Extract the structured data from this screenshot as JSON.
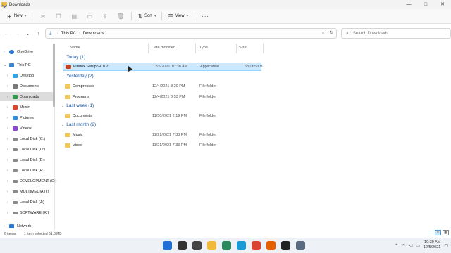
{
  "window": {
    "title": "Downloads",
    "controls": [
      "—",
      "□",
      "✕"
    ]
  },
  "toolbar": {
    "new_label": "New",
    "sort_label": "Sort",
    "view_label": "View",
    "more": "···"
  },
  "address": {
    "crumbs": [
      "This PC",
      "Downloads"
    ],
    "search_placeholder": "Search Downloads"
  },
  "sidebar": {
    "items": [
      {
        "label": "OneDrive",
        "icon": "cloud-icon",
        "color": "#2a7ad5"
      },
      {
        "label": "This PC",
        "icon": "computer-icon",
        "color": "#3b83d4"
      },
      {
        "label": "Desktop",
        "icon": "desktop-icon",
        "color": "#2fa4e7"
      },
      {
        "label": "Documents",
        "icon": "documents-icon",
        "color": "#7a7a7a"
      },
      {
        "label": "Downloads",
        "icon": "download-icon",
        "color": "#2a9d4a"
      },
      {
        "label": "Music",
        "icon": "music-icon",
        "color": "#d9462b"
      },
      {
        "label": "Pictures",
        "icon": "pictures-icon",
        "color": "#2d8be0"
      },
      {
        "label": "Videos",
        "icon": "videos-icon",
        "color": "#8a4bd0"
      },
      {
        "label": "Local Disk (C:)",
        "icon": "drive-icon",
        "color": "#8a8a8a"
      },
      {
        "label": "Local Disk (D:)",
        "icon": "drive-icon",
        "color": "#8a8a8a"
      },
      {
        "label": "Local Disk (E:)",
        "icon": "drive-icon",
        "color": "#8a8a8a"
      },
      {
        "label": "Local Disk (F:)",
        "icon": "drive-icon",
        "color": "#8a8a8a"
      },
      {
        "label": "DEVELOPMENT (G:)",
        "icon": "drive-icon",
        "color": "#8a8a8a"
      },
      {
        "label": "MULTIMEDIA (I:)",
        "icon": "drive-icon",
        "color": "#8a8a8a"
      },
      {
        "label": "Local Disk (J:)",
        "icon": "drive-icon",
        "color": "#8a8a8a"
      },
      {
        "label": "SOFTWARE (K:)",
        "icon": "drive-icon",
        "color": "#8a8a8a"
      },
      {
        "label": "Network",
        "icon": "network-icon",
        "color": "#2a7ad5"
      }
    ]
  },
  "columns": {
    "name": "Name",
    "date": "Date modified",
    "type": "Type",
    "size": "Size"
  },
  "groups": [
    {
      "label": "Today (1)"
    },
    {
      "label": "Yesterday (2)"
    },
    {
      "label": "Last week (1)"
    },
    {
      "label": "Last month (2)"
    }
  ],
  "files": [
    {
      "name": "Firefox Setup 94.0.2",
      "date": "12/5/2021 10:38 AM",
      "type": "Application",
      "size": "53,065 KB"
    },
    {
      "name": "Compressed",
      "date": "12/4/2021 8:20 PM",
      "type": "File folder",
      "size": ""
    },
    {
      "name": "Programs",
      "date": "12/4/2021 3:53 PM",
      "type": "File folder",
      "size": ""
    },
    {
      "name": "Documents",
      "date": "11/30/2021 2:19 PM",
      "type": "File folder",
      "size": ""
    },
    {
      "name": "Music",
      "date": "11/21/2021 7:33 PM",
      "type": "File folder",
      "size": ""
    },
    {
      "name": "Video",
      "date": "11/21/2021 7:33 PM",
      "type": "File folder",
      "size": ""
    }
  ],
  "status": {
    "items": "6 items",
    "selected": "1 item selected  51.8 MB"
  },
  "taskbar": {
    "apps": [
      {
        "icon": "windows-start-icon",
        "color": "#1f6fd6"
      },
      {
        "icon": "search-icon",
        "color": "#333333"
      },
      {
        "icon": "task-view-icon",
        "color": "#444444"
      },
      {
        "icon": "file-explorer-icon",
        "color": "#f0b93a"
      },
      {
        "icon": "store-icon",
        "color": "#2a8a5c"
      },
      {
        "icon": "edge-icon",
        "color": "#1a9ad6"
      },
      {
        "icon": "chrome-icon",
        "color": "#d9432f"
      },
      {
        "icon": "firefox-icon",
        "color": "#e66000"
      },
      {
        "icon": "github-icon",
        "color": "#222222"
      },
      {
        "icon": "settings-icon",
        "color": "#5b6c80"
      }
    ],
    "time": "10:39 AM",
    "date": "12/5/2021"
  }
}
